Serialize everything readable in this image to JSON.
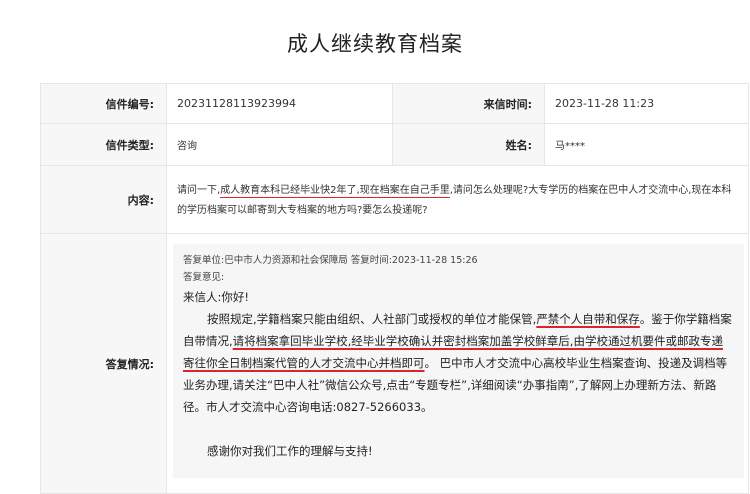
{
  "page": {
    "title": "成人继续教育档案"
  },
  "labels": {
    "letter_no": "信件编号:",
    "received_time": "来信时间:",
    "letter_type": "信件类型:",
    "name": "姓名:",
    "content": "内容:",
    "reply": "答复情况:"
  },
  "letter": {
    "number": "20231128113923994",
    "received_time": "2023-11-28 11:23",
    "type": "咨询",
    "name": "马****",
    "content_parts": [
      "请问一下,",
      "成人教育本科已经毕业快2年了,现在档案在自己手里",
      ",请问怎么处理呢?大专学历的档案在巴中人才交流中心,现在本科的学历档案可以邮寄到大专档案的地方吗?要怎么投递呢?"
    ]
  },
  "reply": {
    "unit_line": "答复单位:巴中市人力资源和社会保障局    答复时间:2023-11-28 15:26",
    "opinion_label": "答复意见:",
    "greeting": "来信人:你好!",
    "para_parts": [
      "按照规定,学籍档案只能由组织、人社部门或授权的单位才能保管,",
      "严禁个人自带和保存",
      "。鉴于你学籍档案自带情况,",
      "请将档案拿回毕业学校,经毕业学校确认并密封档案加盖学校鲜章后,由学校通过机要件或邮政专递寄往你全日制档案代管的人才交流中心并档即可",
      "。 巴中市人才交流中心高校毕业生档案查询、投递及调档等业务办理,请关注“巴中人社”微信公众号,点击“专题专栏”,详细阅读“办事指南”,了解网上办理新方法、新路径。市人才交流中心咨询电话:0827-5266033。"
    ],
    "thanks": "感谢你对我们工作的理解与支持!"
  },
  "colors": {
    "underline": "#d8262a",
    "label_bg": "#f7f7f7",
    "reply_bg": "#f6f6f6",
    "border": "#e6e6e6"
  }
}
